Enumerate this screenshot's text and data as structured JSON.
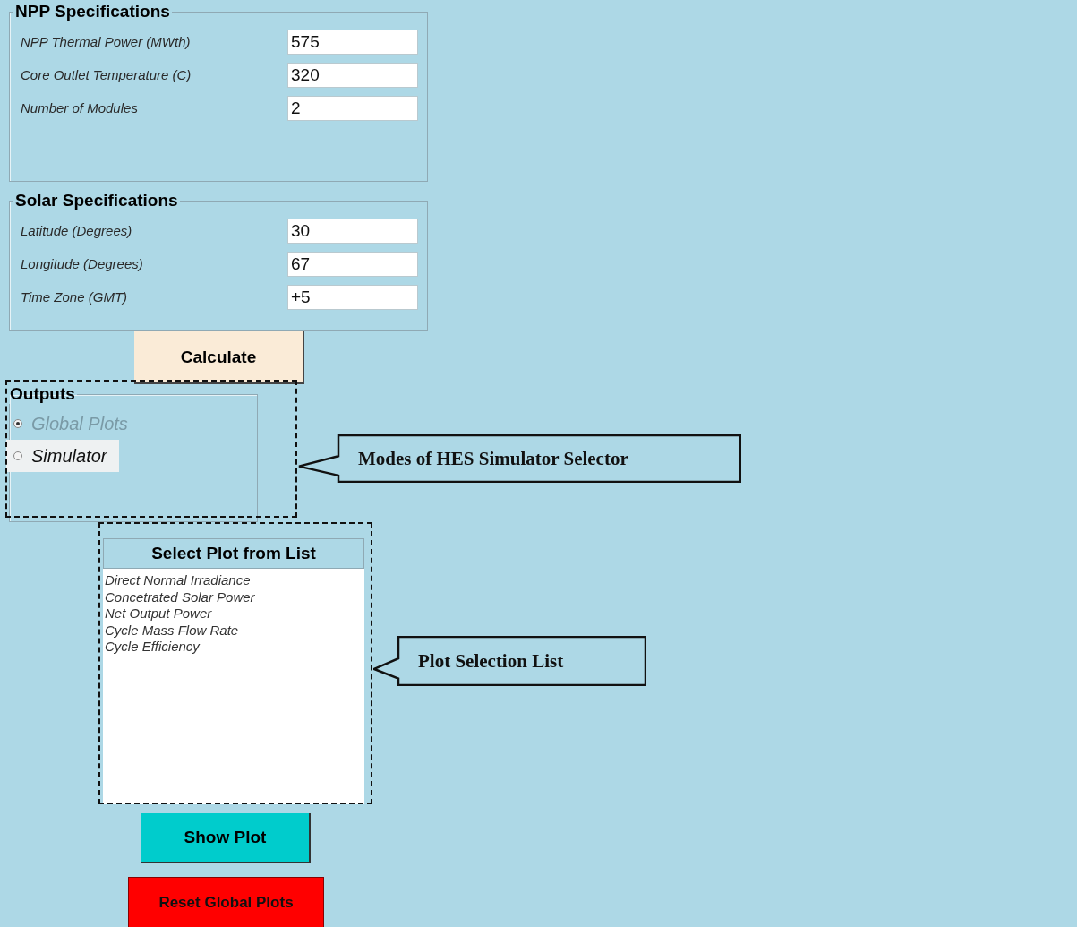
{
  "npp_specifications": {
    "title": "NPP Specifications",
    "fields": [
      {
        "label": "NPP Thermal Power (MWth)",
        "value": "575"
      },
      {
        "label": "Core Outlet Temperature (C)",
        "value": "320"
      },
      {
        "label": "Number of Modules",
        "value": "2"
      }
    ]
  },
  "solar_specifications": {
    "title": "Solar Specifications",
    "fields": [
      {
        "label": "Latitude (Degrees)",
        "value": "30"
      },
      {
        "label": "Longitude (Degrees)",
        "value": "67"
      },
      {
        "label": "Time Zone (GMT)",
        "value": "+5"
      }
    ]
  },
  "calculate_button": "Calculate",
  "outputs": {
    "title": "Outputs",
    "options": [
      {
        "label": "Global Plots",
        "selected": true,
        "disabled": true,
        "focused": false
      },
      {
        "label": "Simulator",
        "selected": false,
        "disabled": false,
        "focused": true
      }
    ]
  },
  "plot_list": {
    "header": "Select Plot from List",
    "items": [
      "Direct Normal Irradiance",
      "Concetrated Solar Power",
      "Net Output Power",
      "Cycle Mass Flow Rate",
      "Cycle Efficiency"
    ]
  },
  "show_plot_button": "Show Plot",
  "reset_button": "Reset Global Plots",
  "callouts": [
    "Modes of HES Simulator Selector",
    "Plot Selection List"
  ]
}
